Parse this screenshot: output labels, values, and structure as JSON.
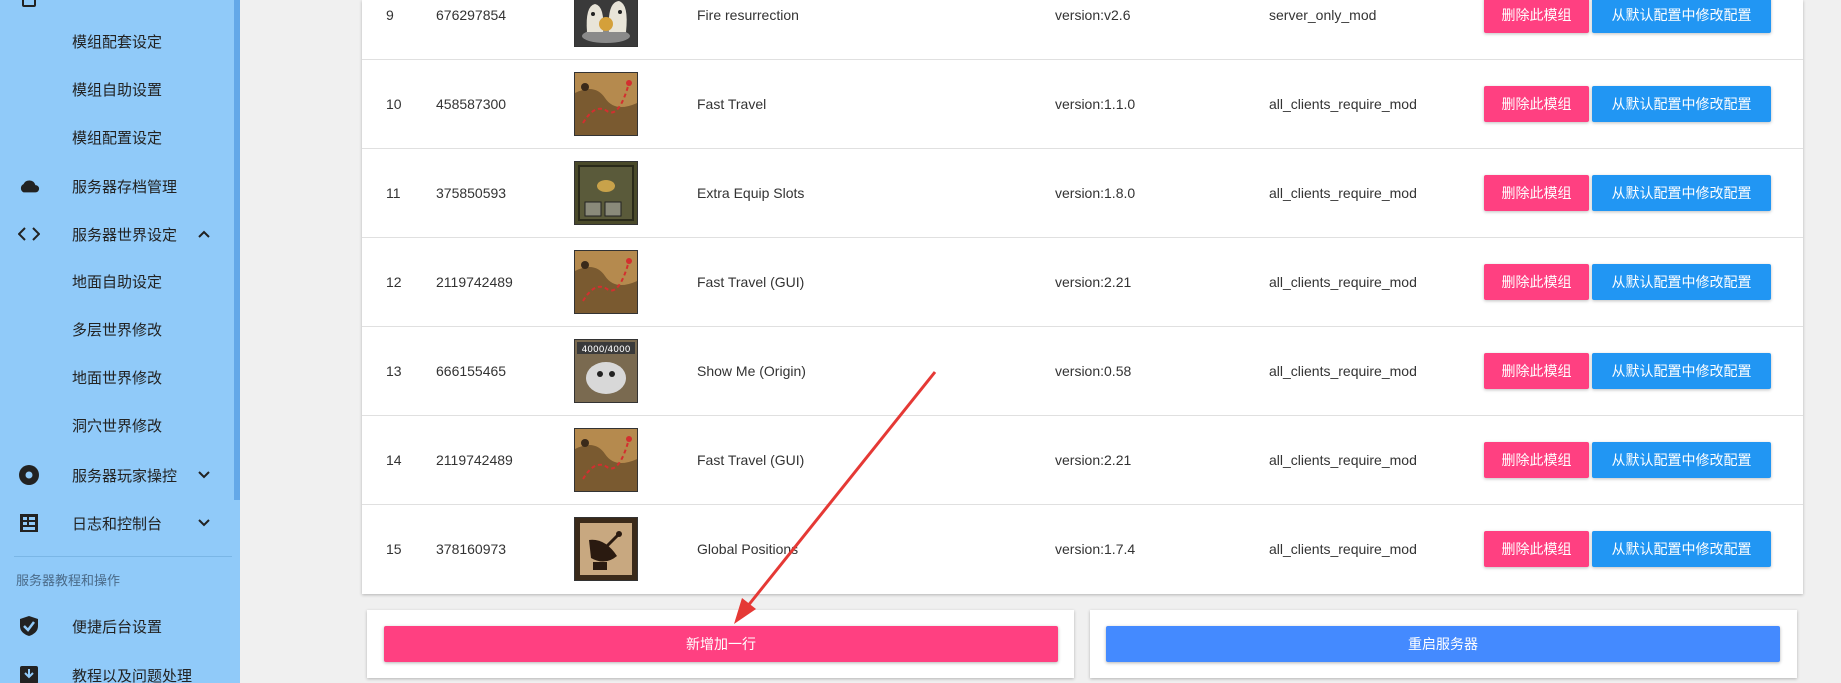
{
  "sidebar": {
    "items": [
      {
        "label": "模组配套设定",
        "icon": "none",
        "level": "sub"
      },
      {
        "label": "模组自助设置",
        "icon": "none",
        "level": "sub"
      },
      {
        "label": "模组配置设定",
        "icon": "none",
        "level": "sub"
      },
      {
        "label": "服务器存档管理",
        "icon": "cloud-icon",
        "level": "top"
      },
      {
        "label": "服务器世界设定",
        "icon": "code-icon",
        "level": "top",
        "expanded": true
      },
      {
        "label": "地面自助设定",
        "icon": "none",
        "level": "sub"
      },
      {
        "label": "多层世界修改",
        "icon": "none",
        "level": "sub"
      },
      {
        "label": "地面世界修改",
        "icon": "none",
        "level": "sub"
      },
      {
        "label": "洞穴世界修改",
        "icon": "none",
        "level": "sub"
      },
      {
        "label": "服务器玩家操控",
        "icon": "disc-icon",
        "level": "top",
        "expanded": false
      },
      {
        "label": "日志和控制台",
        "icon": "log-icon",
        "level": "top",
        "expanded": false
      }
    ],
    "section_label": "服务器教程和操作",
    "bottom_items": [
      {
        "label": "便捷后台设置",
        "icon": "check-shield-icon"
      },
      {
        "label": "教程以及问题处理",
        "icon": "download-box-icon"
      }
    ]
  },
  "mods": {
    "delete_label": "删除此模组",
    "config_label": "从默认配置中修改配置",
    "rows": [
      {
        "index": "9",
        "id": "676297854",
        "name": "Fire resurrection",
        "version": "version:v2.6",
        "type": "server_only_mod",
        "thumb": "ghost"
      },
      {
        "index": "10",
        "id": "458587300",
        "name": "Fast Travel",
        "version": "version:1.1.0",
        "type": "all_clients_require_mod",
        "thumb": "map"
      },
      {
        "index": "11",
        "id": "375850593",
        "name": "Extra Equip Slots",
        "version": "version:1.8.0",
        "type": "all_clients_require_mod",
        "thumb": "slots"
      },
      {
        "index": "12",
        "id": "2119742489",
        "name": "Fast Travel (GUI)",
        "version": "version:2.21",
        "type": "all_clients_require_mod",
        "thumb": "map"
      },
      {
        "index": "13",
        "id": "666155465",
        "name": "Show Me (Origin)",
        "version": "version:0.58",
        "type": "all_clients_require_mod",
        "thumb": "showme"
      },
      {
        "index": "14",
        "id": "2119742489",
        "name": "Fast Travel (GUI)",
        "version": "version:2.21",
        "type": "all_clients_require_mod",
        "thumb": "map"
      },
      {
        "index": "15",
        "id": "378160973",
        "name": "Global Positions",
        "version": "version:1.7.4",
        "type": "all_clients_require_mod",
        "thumb": "dish"
      }
    ]
  },
  "actions": {
    "add_row_label": "新增加一行",
    "restart_label": "重启服务器"
  },
  "thumb_text": {
    "showme": "4000/4000"
  },
  "colors": {
    "sidebar_bg": "#90caf9",
    "delete_button": "#ff4081",
    "config_button": "#2196f3",
    "add_row_button": "#ff4081",
    "restart_button": "#448aff",
    "annotation_arrow": "#e53935"
  }
}
